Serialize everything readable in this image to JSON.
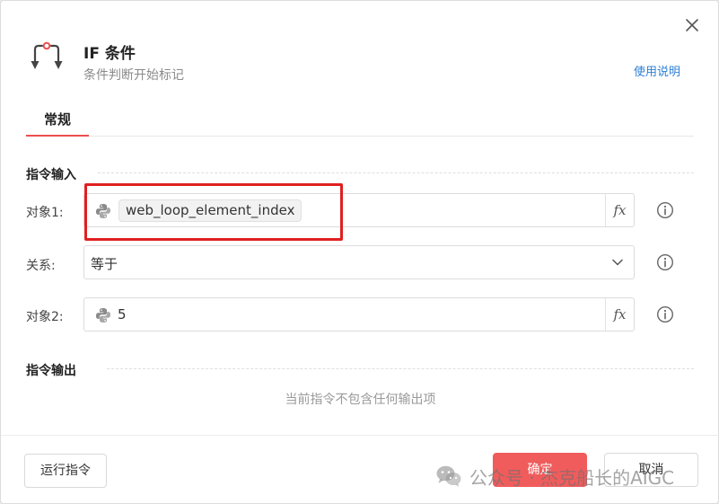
{
  "dialog": {
    "title": "IF 条件",
    "subtitle": "条件判断开始标记",
    "help_link": "使用说明",
    "close_icon": "close-icon",
    "header_icon": "if-condition-icon"
  },
  "tabs": [
    {
      "label": "常规",
      "active": true
    }
  ],
  "input_section": {
    "title": "指令输入",
    "rows": [
      {
        "label": "对象1:",
        "type": "expression",
        "value": "web_loop_element_index",
        "as_tag": true,
        "icon": "python-icon",
        "fx_label": "fx"
      },
      {
        "label": "关系:",
        "type": "select",
        "value": "等于",
        "icon": "chevron-down-icon"
      },
      {
        "label": "对象2:",
        "type": "expression",
        "value": "5",
        "as_tag": false,
        "icon": "python-icon",
        "fx_label": "fx"
      }
    ]
  },
  "output_section": {
    "title": "指令输出",
    "empty_message": "当前指令不包含任何输出项"
  },
  "footer": {
    "run_button": "运行指令",
    "ok_button": "确定",
    "cancel_button": "取消"
  },
  "watermark": {
    "text": "公众号 · 杰克船长的AIGC"
  },
  "colors": {
    "accent_red": "#ec4e4e",
    "ok_button": "#f05c5c",
    "link_blue": "#2d7fd6",
    "highlight_border": "#e02020"
  }
}
